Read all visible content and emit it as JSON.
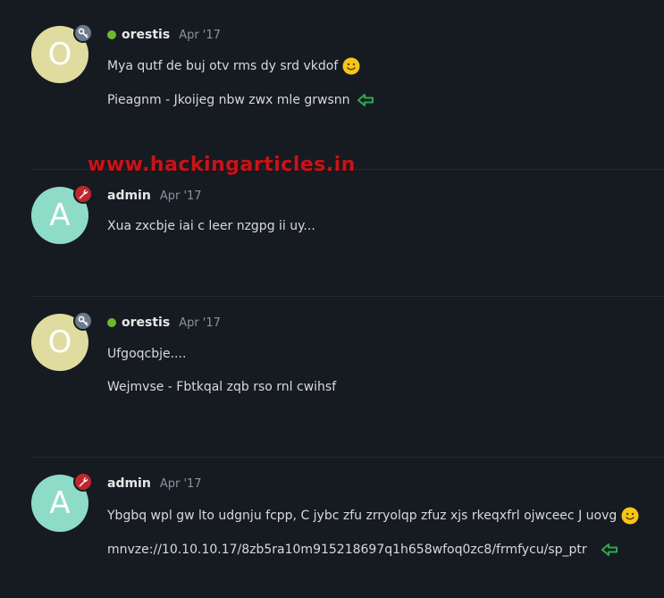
{
  "watermark": "www.hackingarticles.in",
  "posts": [
    {
      "avatar_letter": "O",
      "badge": "key-icon",
      "online": true,
      "username": "orestis",
      "date": "Apr '17",
      "lines": [
        "Mya qutf de buj otv rms dy srd vkdof",
        "Pieagnm - Jkoijeg nbw zwx mle grwsnn"
      ]
    },
    {
      "avatar_letter": "A",
      "badge": "wrench-icon",
      "online": false,
      "username": "admin",
      "date": "Apr '17",
      "lines": [
        "Xua zxcbje iai c leer nzgpg ii uy..."
      ]
    },
    {
      "avatar_letter": "O",
      "badge": "key-icon",
      "online": true,
      "username": "orestis",
      "date": "Apr '17",
      "lines": [
        "Ufgoqcbje....",
        "Wejmvse - Fbtkqal zqb rso rnl cwihsf"
      ]
    },
    {
      "avatar_letter": "A",
      "badge": "wrench-icon",
      "online": false,
      "username": "admin",
      "date": "Apr '17",
      "lines": [
        "Ybgbq wpl gw lto udgnju fcpp, C jybc zfu zrryolqp zfuz xjs rkeqxfrl ojwceec J uovg",
        "mnvze://10.10.10.17/8zb5ra10m915218697q1h658wfoq0zc8/frmfycu/sp_ptr"
      ]
    }
  ],
  "colors": {
    "background": "#161b22",
    "online": "#6bb92d",
    "watermark": "#c4151c",
    "arrow": "#2fa84f"
  }
}
